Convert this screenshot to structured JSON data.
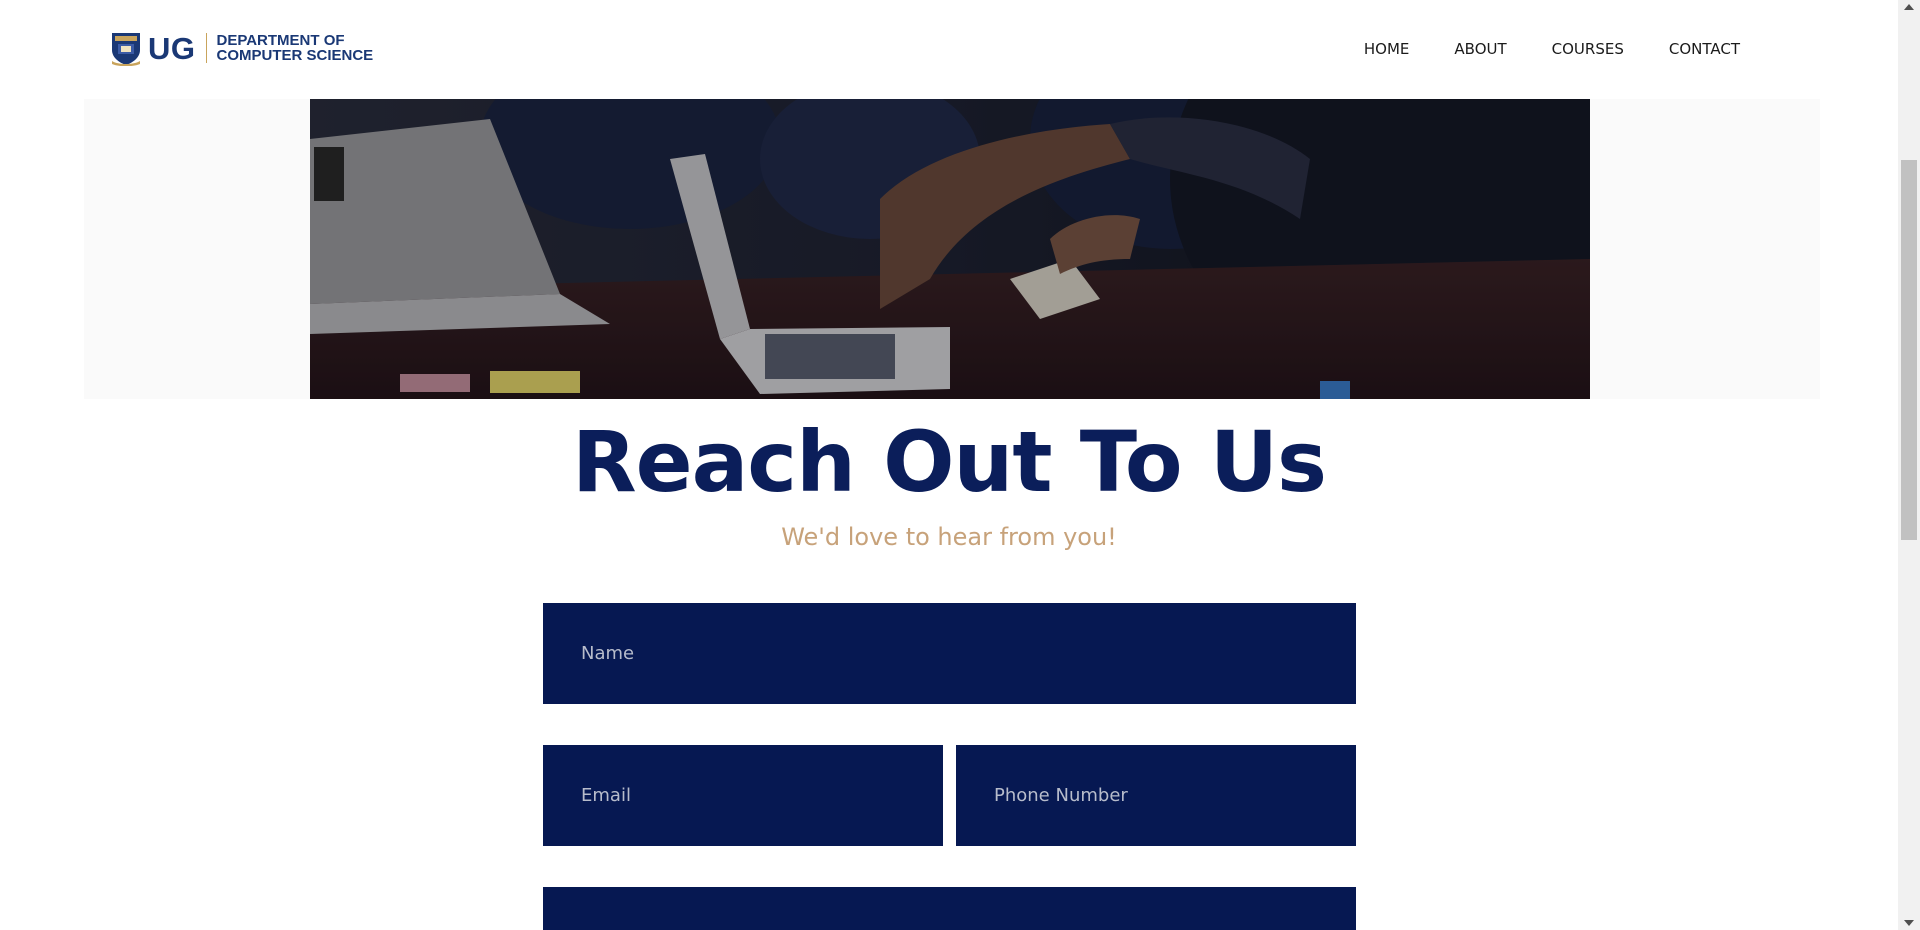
{
  "brand": {
    "mark": "UG",
    "dept_line1": "DEPARTMENT OF",
    "dept_line2": "COMPUTER SCIENCE",
    "crest_icon": "university-crest-icon",
    "primary_color": "#1a3875",
    "accent_color": "#c9a45c"
  },
  "nav": {
    "items": [
      {
        "label": "HOME"
      },
      {
        "label": "ABOUT"
      },
      {
        "label": "COURSES"
      },
      {
        "label": "CONTACT"
      }
    ]
  },
  "hero": {
    "image": "students-with-laptops-photo"
  },
  "contact": {
    "title": "Reach Out To Us",
    "subtitle": "We'd love to hear from you!",
    "title_color": "#0b1e5a",
    "subtitle_color": "#c7a27a",
    "field_color": "#061852",
    "fields": {
      "name_placeholder": "Name",
      "email_placeholder": "Email",
      "phone_placeholder": "Phone Number",
      "message_placeholder": ""
    }
  }
}
